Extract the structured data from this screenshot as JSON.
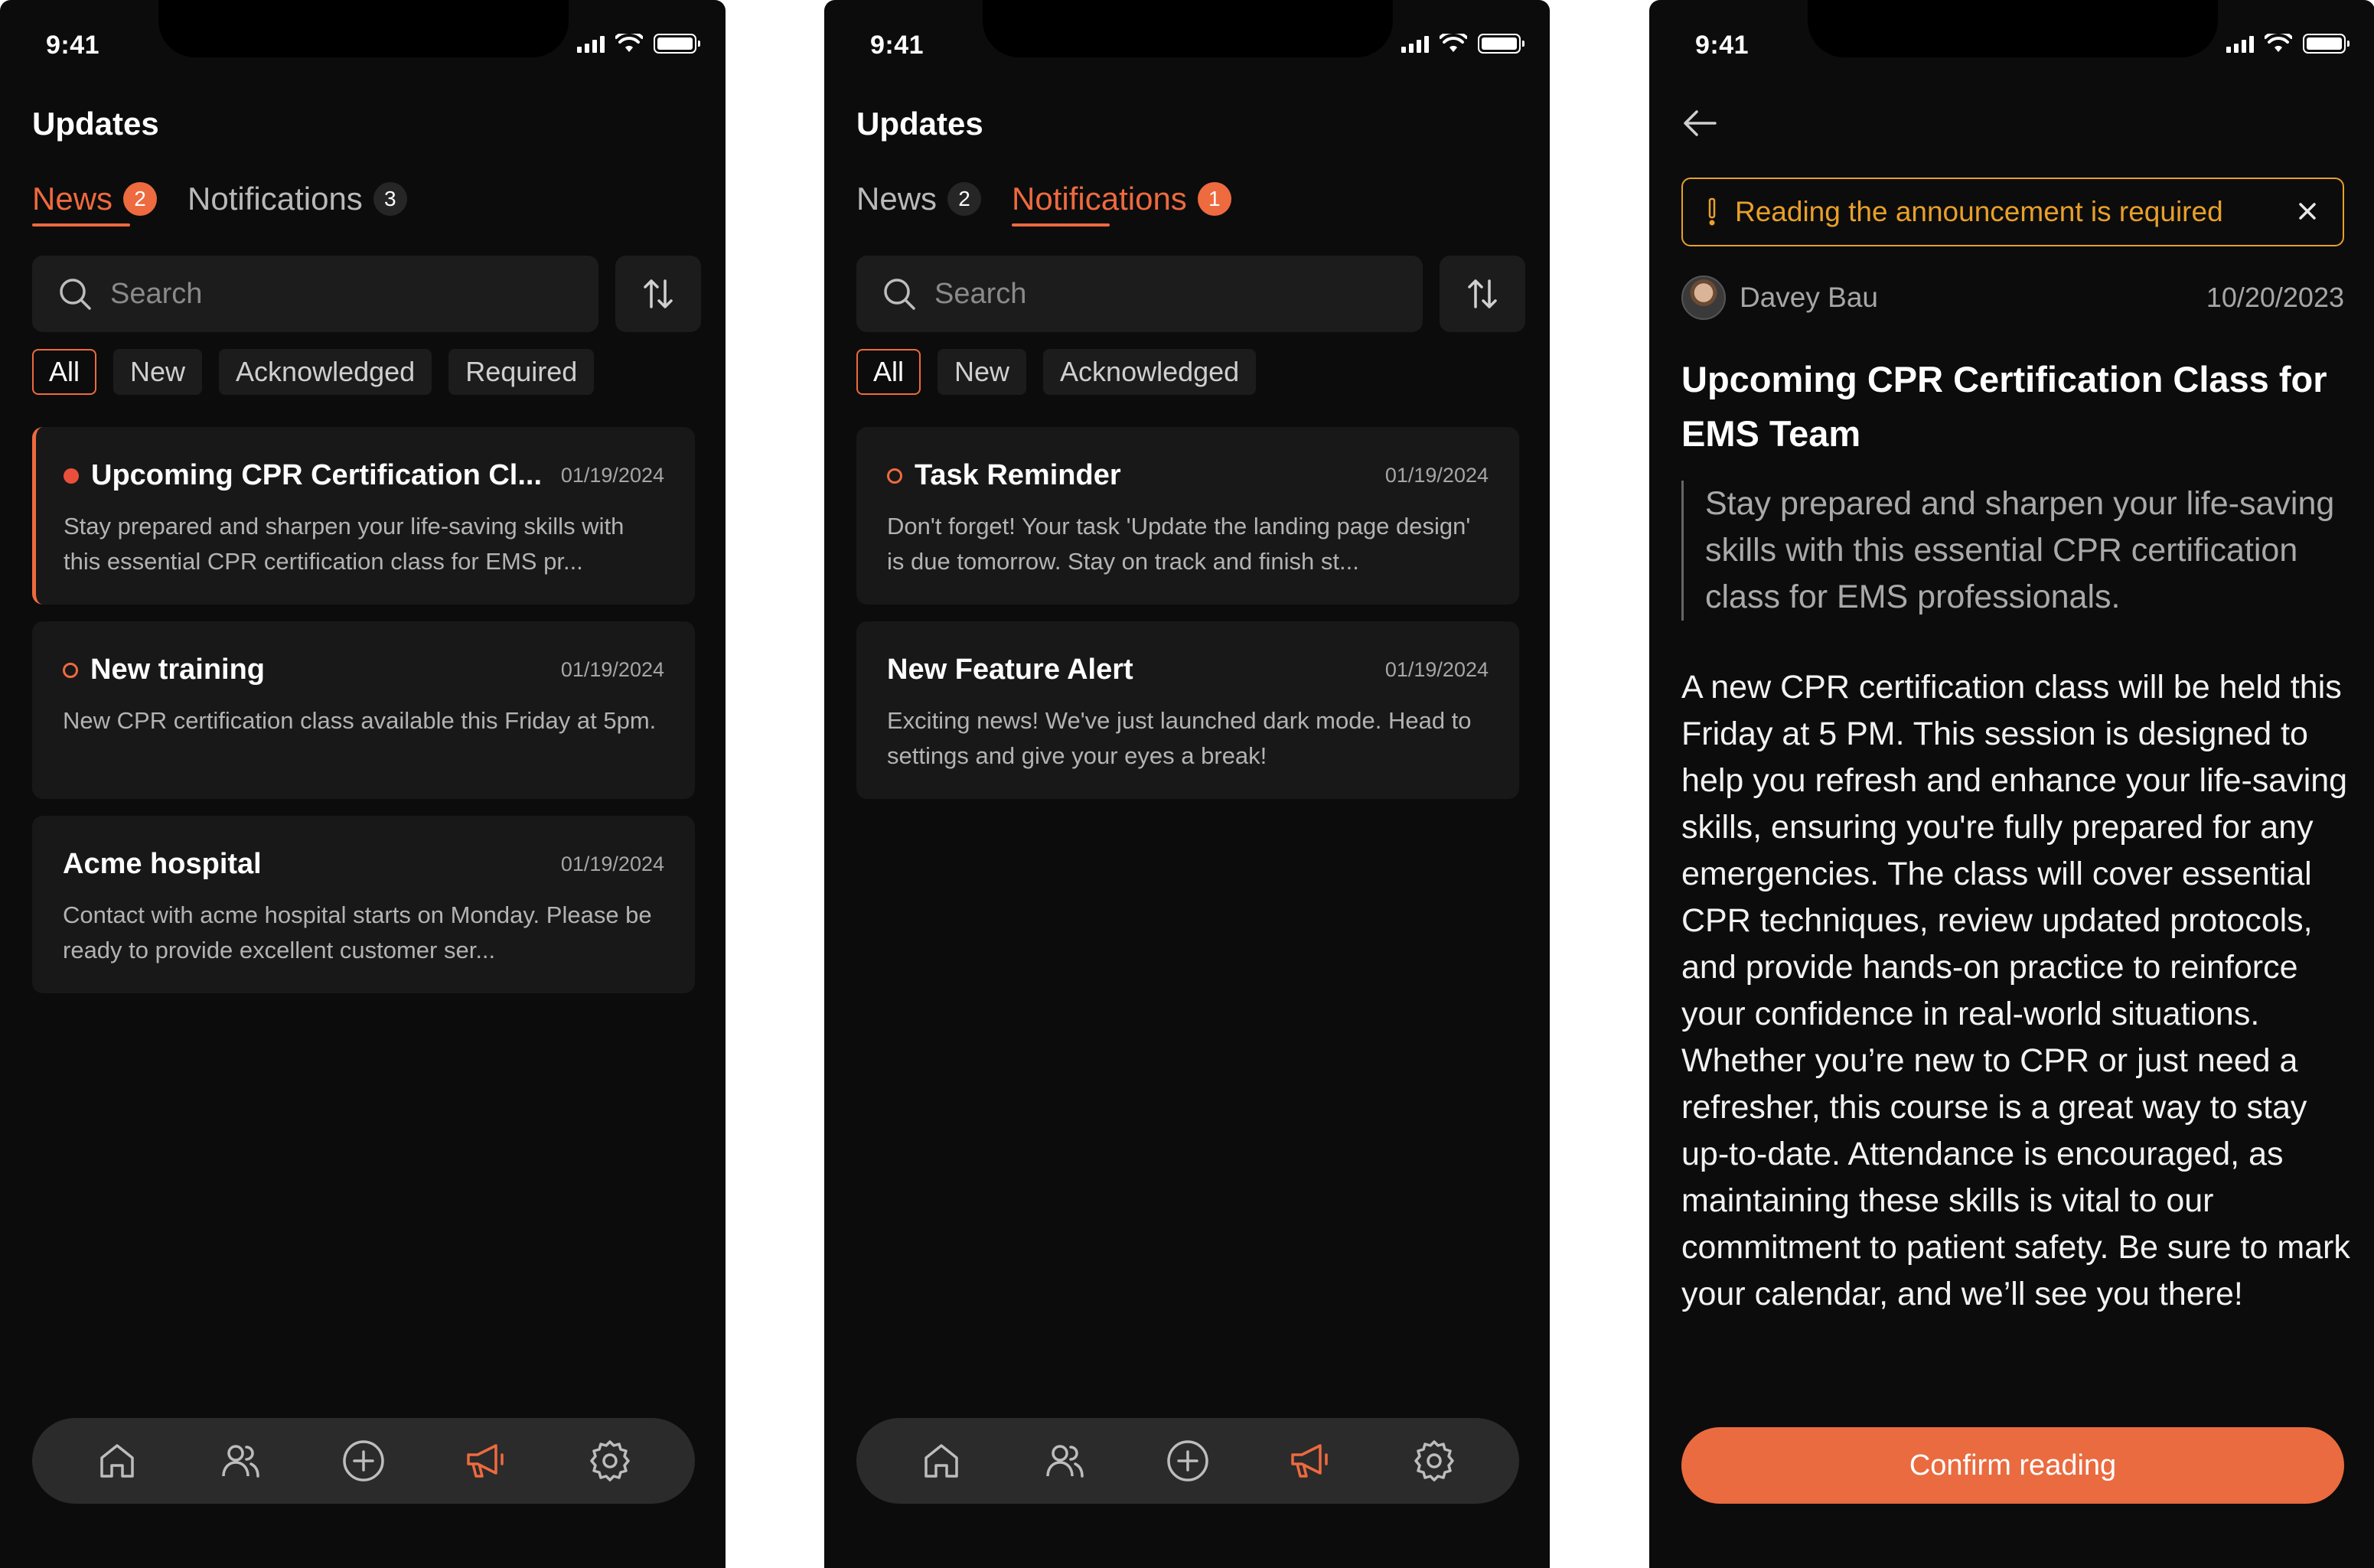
{
  "status": {
    "time": "9:41"
  },
  "colors": {
    "accent": "#ee6a3f",
    "warning": "#e8a02a",
    "background": "#0c0c0c",
    "card": "#181818"
  },
  "screen1": {
    "title": "Updates",
    "tabs": [
      {
        "label": "News",
        "count": "2",
        "active": true
      },
      {
        "label": "Notifications",
        "count": "3",
        "active": false
      }
    ],
    "search_placeholder": "Search",
    "filters": [
      "All",
      "New",
      "Acknowledged",
      "Required"
    ],
    "items": [
      {
        "title": "Upcoming CPR Certification Cl...",
        "date": "01/19/2024",
        "body": "Stay prepared and sharpen your life-saving skills with this essential CPR certification class for EMS pr...",
        "status": "unread-required"
      },
      {
        "title": "New training",
        "date": "01/19/2024",
        "body": "New CPR certification class available this Friday at 5pm.",
        "status": "new"
      },
      {
        "title": "Acme hospital",
        "date": "01/19/2024",
        "body": "Contact with acme hospital starts on Monday. Please be ready to provide excellent customer ser...",
        "status": "read"
      }
    ]
  },
  "screen2": {
    "title": "Updates",
    "tabs": [
      {
        "label": "News",
        "count": "2",
        "active": false
      },
      {
        "label": "Notifications",
        "count": "1",
        "active": true
      }
    ],
    "search_placeholder": "Search",
    "filters": [
      "All",
      "New",
      "Acknowledged"
    ],
    "items": [
      {
        "title": "Task Reminder",
        "date": "01/19/2024",
        "body": "Don't forget! Your task 'Update the landing page design' is due tomorrow. Stay on track and finish st...",
        "status": "new"
      },
      {
        "title": "New Feature Alert",
        "date": "01/19/2024",
        "body": "Exciting news! We've just launched dark mode. Head to settings and give your eyes a break!",
        "status": "read"
      }
    ]
  },
  "nav": {
    "items": [
      {
        "icon": "home-icon",
        "active": false
      },
      {
        "icon": "users-icon",
        "active": false
      },
      {
        "icon": "plus-circle-icon",
        "active": false
      },
      {
        "icon": "megaphone-icon",
        "active": true
      },
      {
        "icon": "gear-icon",
        "active": false
      }
    ]
  },
  "screen3": {
    "alert_text": "Reading the announcement is required",
    "author": "Davey Bau",
    "date": "10/20/2023",
    "title": "Upcoming CPR Certification Class for EMS Team",
    "summary": "Stay prepared and sharpen your life-saving skills with this essential CPR certification class for EMS professionals.",
    "body": "A new CPR certification class will be held this Friday at 5 PM. This session is designed to help you refresh and enhance your life-saving skills, ensuring you're fully prepared for any emergencies. The class will cover essential CPR techniques, review updated protocols, and provide hands-on practice to reinforce your confidence in real-world situations. Whether you’re new to CPR or just need a refresher, this course is a great way to stay up-to-date. Attendance is encouraged, as maintaining these skills is vital to our commitment to patient safety. Be sure to mark your calendar, and we’ll see you there!",
    "confirm_label": "Confirm reading"
  }
}
